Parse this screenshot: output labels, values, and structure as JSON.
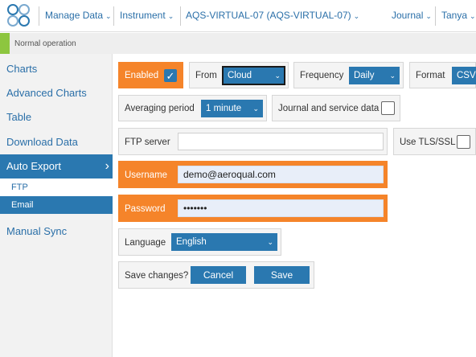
{
  "topbar": {
    "manage_data": "Manage Data",
    "instrument": "Instrument",
    "device": "AQS-VIRTUAL-07 (AQS-VIRTUAL-07)",
    "journal": "Journal",
    "user": "Tanya",
    "caret": "⌄"
  },
  "status": {
    "text": "Normal operation",
    "color": "#8dc63f"
  },
  "sidebar": {
    "items": [
      {
        "label": "Charts"
      },
      {
        "label": "Advanced Charts"
      },
      {
        "label": "Table"
      },
      {
        "label": "Download Data"
      },
      {
        "label": "Auto Export"
      },
      {
        "label": "Manual Sync"
      }
    ],
    "sub_items": [
      {
        "label": "FTP"
      },
      {
        "label": "Email"
      }
    ],
    "chevron": "›"
  },
  "form": {
    "enabled_label": "Enabled",
    "enabled_checked": true,
    "from_label": "From",
    "from_value": "Cloud",
    "frequency_label": "Frequency",
    "frequency_value": "Daily",
    "format_label": "Format",
    "format_value": "CSV",
    "averaging_label": "Averaging period",
    "averaging_value": "1 minute",
    "journal_label": "Journal and service data",
    "journal_checked": false,
    "ftp_server_label": "FTP server",
    "ftp_server_value": "",
    "tls_label": "Use TLS/SSL",
    "tls_checked": false,
    "username_label": "Username",
    "username_value": "demo@aeroqual.com",
    "password_label": "Password",
    "password_value": "•••••••",
    "language_label": "Language",
    "language_value": "English",
    "save_changes_label": "Save changes?",
    "cancel_label": "Cancel",
    "save_label": "Save",
    "checkmark": "✓"
  },
  "colors": {
    "accent": "#2a78b0",
    "warning": "#f5842a"
  }
}
